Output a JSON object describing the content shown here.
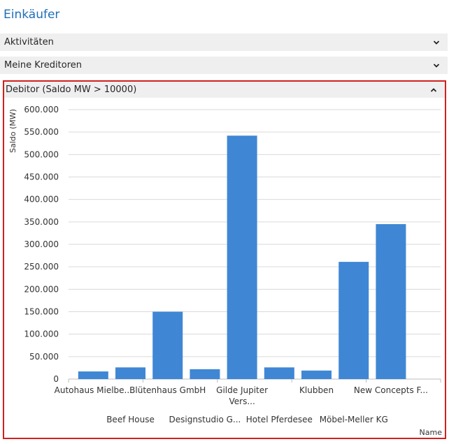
{
  "page": {
    "title": "Einkäufer"
  },
  "parts": [
    {
      "label": "Aktivitäten",
      "icon": "chevron-down-icon"
    },
    {
      "label": "Meine Kreditoren",
      "icon": "chevron-down-icon"
    }
  ],
  "chart_part": {
    "label": "Debitor (Saldo MW > 10000)",
    "icon": "chevron-up-icon"
  },
  "colors": {
    "accent": "#1e6fb8",
    "bar": "#3f87d4",
    "highlight_border": "#d21f1f"
  },
  "chart_data": {
    "type": "bar",
    "ylabel": "Saldo (MW)",
    "xlabel": "Name",
    "ylim": [
      0,
      600000
    ],
    "yticks": [
      "0",
      "50.000",
      "100.000",
      "150.000",
      "200.000",
      "250.000",
      "300.000",
      "350.000",
      "400.000",
      "450.000",
      "500.000",
      "550.000",
      "600.000"
    ],
    "categories": [
      "Autohaus Mielbe...",
      "Beef House",
      "Blütenhaus GmbH",
      "Designstudio G...",
      "Gilde Jupiter Vers...",
      "Hotel Pferdesee",
      "Klubben",
      "Möbel-Meller KG",
      "New Concepts F..."
    ],
    "values": [
      17000,
      26000,
      150000,
      22000,
      542000,
      26000,
      19000,
      261000,
      345000
    ],
    "grid": true,
    "legend": "none"
  }
}
